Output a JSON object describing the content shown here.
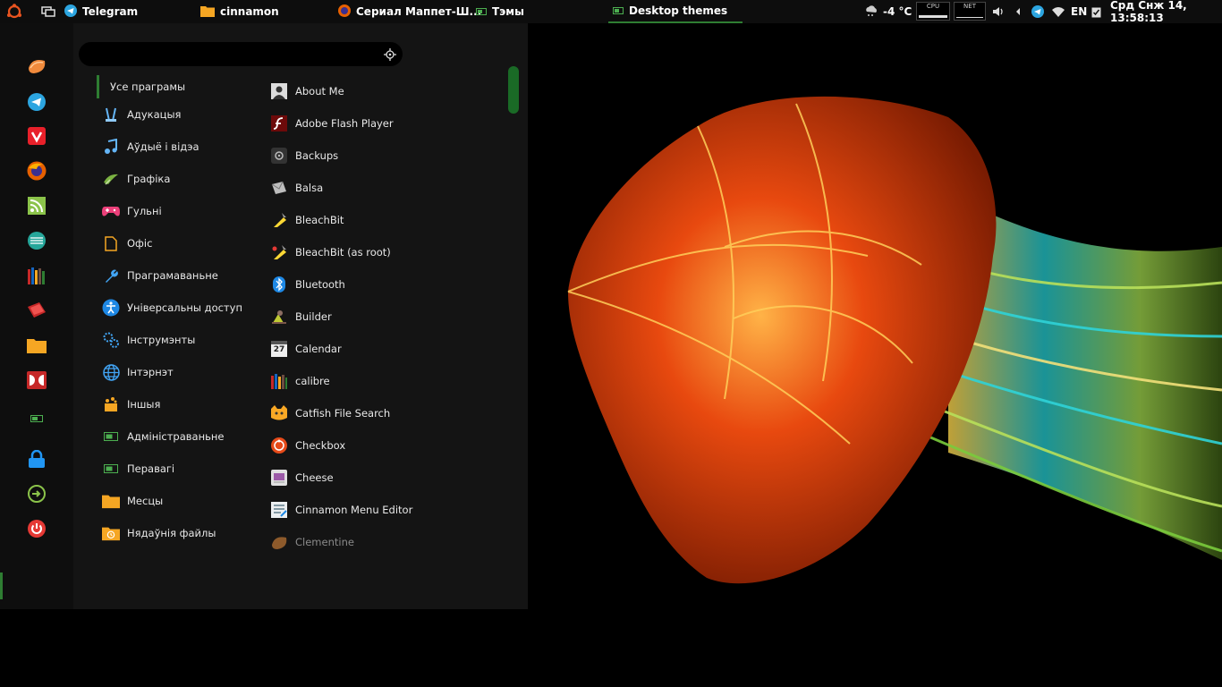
{
  "panel": {
    "tasks": [
      {
        "label": "Telegram",
        "icon": "telegram-icon"
      },
      {
        "label": "cinnamon",
        "icon": "folder-icon"
      },
      {
        "label": "Сериал Маппет-Ш...",
        "icon": "firefox-icon"
      },
      {
        "label": "Тэмы",
        "icon": "settings-icon"
      },
      {
        "label": "Desktop themes",
        "icon": "settings-icon"
      }
    ],
    "weather": "-4 °C",
    "cpu_label": "CPU",
    "net_label": "NET",
    "keyboard_layout": "EN",
    "clock": "Срд Снж 14, 13:58:13"
  },
  "menu": {
    "search_value": "",
    "categories": [
      {
        "label": "Усе праграмы",
        "icon": ""
      },
      {
        "label": "Адукацыя",
        "icon": "education-icon"
      },
      {
        "label": "Аўдыё і відэа",
        "icon": "music-icon"
      },
      {
        "label": "Графіка",
        "icon": "graphics-icon"
      },
      {
        "label": "Гульні",
        "icon": "gamepad-icon"
      },
      {
        "label": "Офіс",
        "icon": "document-icon"
      },
      {
        "label": "Праграмаваньне",
        "icon": "wrench-icon"
      },
      {
        "label": "Універсальны доступ",
        "icon": "accessibility-icon"
      },
      {
        "label": "Інструмэнты",
        "icon": "gears-icon"
      },
      {
        "label": "Інтэрнэт",
        "icon": "globe-icon"
      },
      {
        "label": "Іншыя",
        "icon": "other-icon"
      },
      {
        "label": "Адміністраваньне",
        "icon": "settings-icon"
      },
      {
        "label": "Перавагі",
        "icon": "settings-icon"
      },
      {
        "label": "Месцы",
        "icon": "folder-icon"
      },
      {
        "label": "Нядаўнія файлы",
        "icon": "recent-folder-icon"
      }
    ],
    "apps": [
      {
        "label": "About Me",
        "icon": "user-icon"
      },
      {
        "label": "Adobe Flash Player",
        "icon": "flash-icon"
      },
      {
        "label": "Backups",
        "icon": "backup-icon"
      },
      {
        "label": "Balsa",
        "icon": "mail-icon"
      },
      {
        "label": "BleachBit",
        "icon": "bleachbit-icon"
      },
      {
        "label": "BleachBit (as root)",
        "icon": "bleachbit-root-icon"
      },
      {
        "label": "Bluetooth",
        "icon": "bluetooth-icon"
      },
      {
        "label": "Builder",
        "icon": "builder-icon"
      },
      {
        "label": "Calendar",
        "icon": "calendar-icon"
      },
      {
        "label": "calibre",
        "icon": "books-icon"
      },
      {
        "label": "Catfish File Search",
        "icon": "catfish-icon"
      },
      {
        "label": "Checkbox",
        "icon": "checkbox-icon"
      },
      {
        "label": "Cheese",
        "icon": "cheese-icon"
      },
      {
        "label": "Cinnamon Menu Editor",
        "icon": "menu-editor-icon"
      },
      {
        "label": "Clementine",
        "icon": "clementine-icon"
      }
    ],
    "calendar_icon_day": "27"
  },
  "favorites": [
    "clementine-icon",
    "telegram-icon",
    "vivaldi-icon",
    "firefox-icon",
    "rss-icon",
    "network-icon",
    "library-icon",
    "book-icon",
    "files-icon",
    "doublecmd-icon",
    "settings-icon",
    "lock-icon",
    "logout-icon",
    "power-icon"
  ],
  "colors": {
    "accent": "#2e7d32",
    "panel_bg": "#0d0d0d",
    "menu_bg": "#141414",
    "telegram": "#2ca5e0",
    "folder": "#f5a623"
  }
}
